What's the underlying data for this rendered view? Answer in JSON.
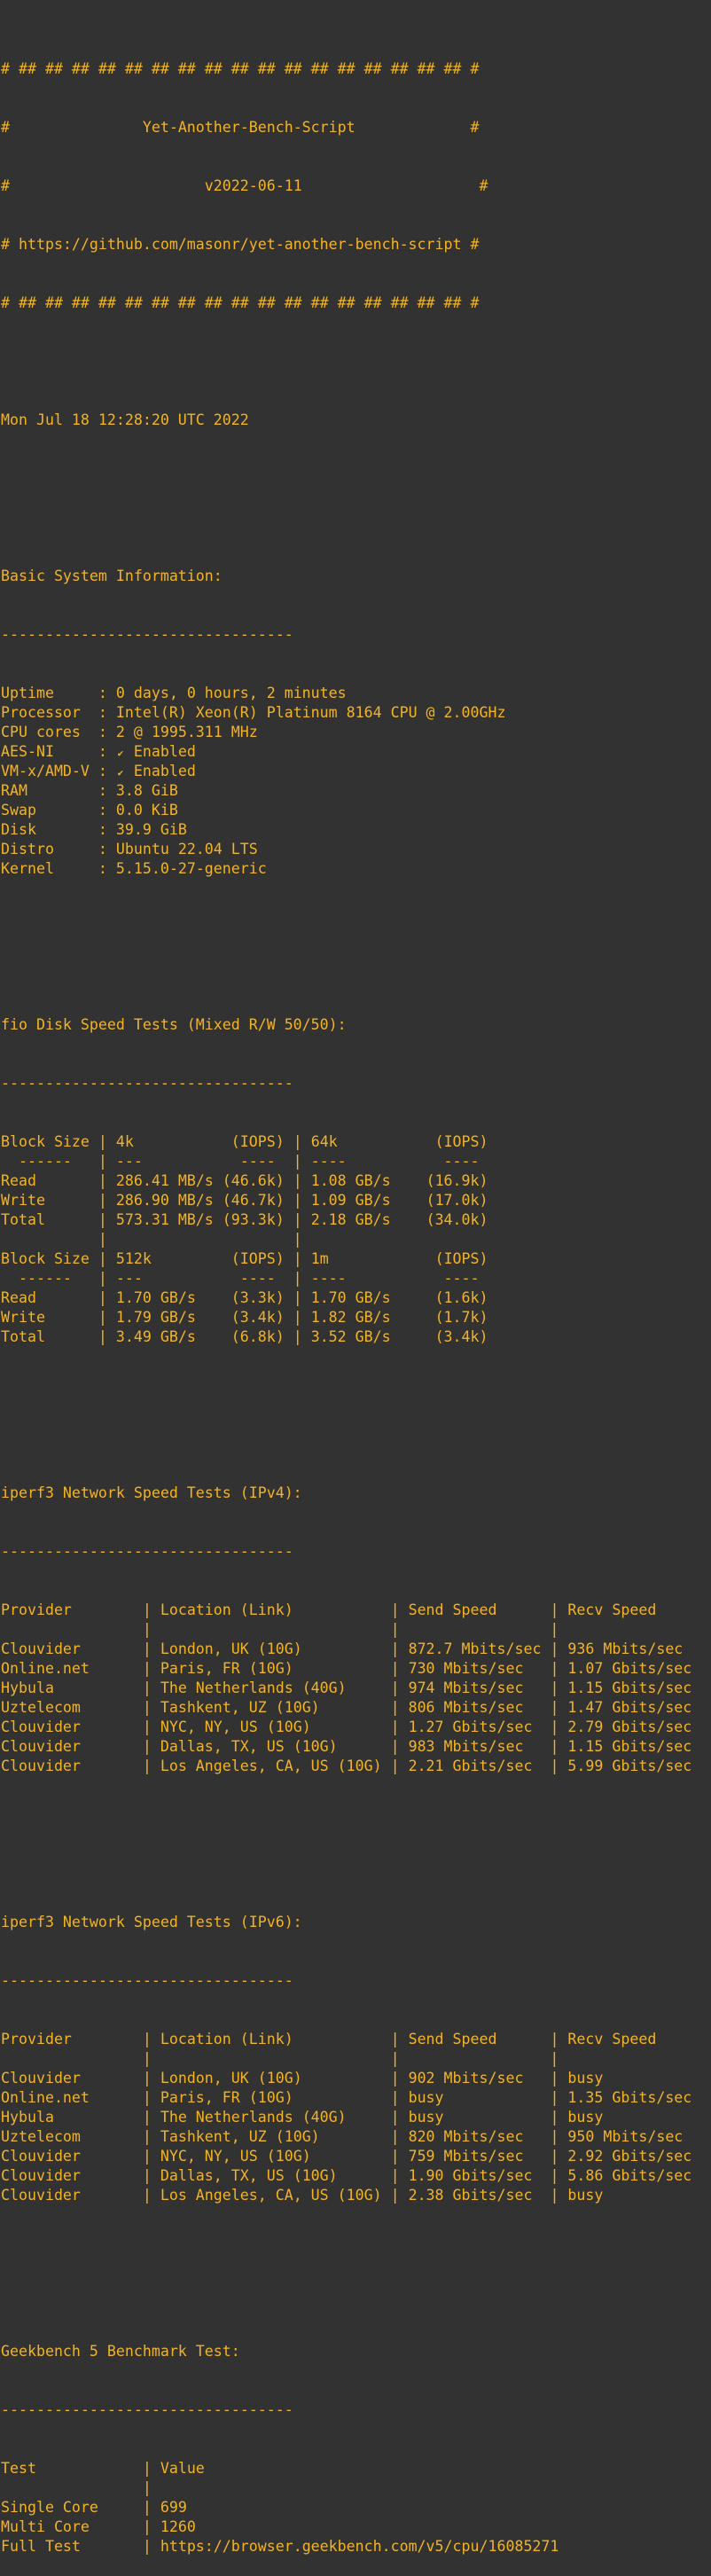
{
  "colors": {
    "background": "#323232",
    "text": "#f2b425"
  },
  "banner": {
    "border": "# ## ## ## ## ## ## ## ## ## ## ## ## ## ## ## ## ## #",
    "title": "Yet-Another-Bench-Script",
    "version": "v2022-06-11",
    "url": "https://github.com/masonr/yet-another-bench-script"
  },
  "timestamp": "Mon Jul 18 12:28:20 UTC 2022",
  "divider": "---------------------------------",
  "system": {
    "title": "Basic System Information:",
    "rows": [
      {
        "label": "Uptime",
        "value": "0 days, 0 hours, 2 minutes"
      },
      {
        "label": "Processor",
        "value": "Intel(R) Xeon(R) Platinum 8164 CPU @ 2.00GHz"
      },
      {
        "label": "CPU cores",
        "value": "2 @ 1995.311 MHz"
      },
      {
        "label": "AES-NI",
        "icon": "check-icon",
        "value": "Enabled"
      },
      {
        "label": "VM-x/AMD-V",
        "icon": "check-icon",
        "value": "Enabled"
      },
      {
        "label": "RAM",
        "value": "3.8 GiB"
      },
      {
        "label": "Swap",
        "value": "0.0 KiB"
      },
      {
        "label": "Disk",
        "value": "39.9 GiB"
      },
      {
        "label": "Distro",
        "value": "Ubuntu 22.04 LTS"
      },
      {
        "label": "Kernel",
        "value": "5.15.0-27-generic"
      }
    ]
  },
  "fio": {
    "title": "fio Disk Speed Tests (Mixed R/W 50/50):",
    "header_label": "Block Size",
    "iops_label": "(IOPS)",
    "tables": [
      {
        "sizes": [
          "4k",
          "64k"
        ],
        "rows": [
          {
            "label": "Read",
            "a": "286.41 MB/s",
            "a_iops": "(46.6k)",
            "b": "1.08 GB/s",
            "b_iops": "(16.9k)"
          },
          {
            "label": "Write",
            "a": "286.90 MB/s",
            "a_iops": "(46.7k)",
            "b": "1.09 GB/s",
            "b_iops": "(17.0k)"
          },
          {
            "label": "Total",
            "a": "573.31 MB/s",
            "a_iops": "(93.3k)",
            "b": "2.18 GB/s",
            "b_iops": "(34.0k)"
          }
        ]
      },
      {
        "sizes": [
          "512k",
          "1m"
        ],
        "rows": [
          {
            "label": "Read",
            "a": "1.70 GB/s",
            "a_iops": "(3.3k)",
            "b": "1.70 GB/s",
            "b_iops": "(1.6k)"
          },
          {
            "label": "Write",
            "a": "1.79 GB/s",
            "a_iops": "(3.4k)",
            "b": "1.82 GB/s",
            "b_iops": "(1.7k)"
          },
          {
            "label": "Total",
            "a": "3.49 GB/s",
            "a_iops": "(6.8k)",
            "b": "3.52 GB/s",
            "b_iops": "(3.4k)"
          }
        ]
      }
    ]
  },
  "iperf_columns": [
    "Provider",
    "Location (Link)",
    "Send Speed",
    "Recv Speed"
  ],
  "iperf4": {
    "title": "iperf3 Network Speed Tests (IPv4):",
    "rows": [
      {
        "provider": "Clouvider",
        "location": "London, UK (10G)",
        "send": "872.7 Mbits/sec",
        "recv": "936 Mbits/sec"
      },
      {
        "provider": "Online.net",
        "location": "Paris, FR (10G)",
        "send": "730 Mbits/sec",
        "recv": "1.07 Gbits/sec"
      },
      {
        "provider": "Hybula",
        "location": "The Netherlands (40G)",
        "send": "974 Mbits/sec",
        "recv": "1.15 Gbits/sec"
      },
      {
        "provider": "Uztelecom",
        "location": "Tashkent, UZ (10G)",
        "send": "806 Mbits/sec",
        "recv": "1.47 Gbits/sec"
      },
      {
        "provider": "Clouvider",
        "location": "NYC, NY, US (10G)",
        "send": "1.27 Gbits/sec",
        "recv": "2.79 Gbits/sec"
      },
      {
        "provider": "Clouvider",
        "location": "Dallas, TX, US (10G)",
        "send": "983 Mbits/sec",
        "recv": "1.15 Gbits/sec"
      },
      {
        "provider": "Clouvider",
        "location": "Los Angeles, CA, US (10G)",
        "send": "2.21 Gbits/sec",
        "recv": "5.99 Gbits/sec"
      }
    ]
  },
  "iperf6": {
    "title": "iperf3 Network Speed Tests (IPv6):",
    "rows": [
      {
        "provider": "Clouvider",
        "location": "London, UK (10G)",
        "send": "902 Mbits/sec",
        "recv": "busy"
      },
      {
        "provider": "Online.net",
        "location": "Paris, FR (10G)",
        "send": "busy",
        "recv": "1.35 Gbits/sec"
      },
      {
        "provider": "Hybula",
        "location": "The Netherlands (40G)",
        "send": "busy",
        "recv": "busy"
      },
      {
        "provider": "Uztelecom",
        "location": "Tashkent, UZ (10G)",
        "send": "820 Mbits/sec",
        "recv": "950 Mbits/sec"
      },
      {
        "provider": "Clouvider",
        "location": "NYC, NY, US (10G)",
        "send": "759 Mbits/sec",
        "recv": "2.92 Gbits/sec"
      },
      {
        "provider": "Clouvider",
        "location": "Dallas, TX, US (10G)",
        "send": "1.90 Gbits/sec",
        "recv": "5.86 Gbits/sec"
      },
      {
        "provider": "Clouvider",
        "location": "Los Angeles, CA, US (10G)",
        "send": "2.38 Gbits/sec",
        "recv": "busy"
      }
    ]
  },
  "geekbench": {
    "title": "Geekbench 5 Benchmark Test:",
    "columns": [
      "Test",
      "Value"
    ],
    "rows": [
      {
        "test": "Single Core",
        "value": "699"
      },
      {
        "test": "Multi Core",
        "value": "1260"
      },
      {
        "test": "Full Test",
        "value": "https://browser.geekbench.com/v5/cpu/16085271"
      }
    ]
  }
}
